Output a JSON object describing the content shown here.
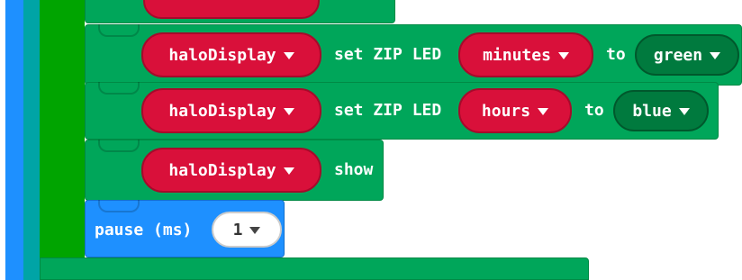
{
  "blocks": {
    "led_minutes": {
      "variable": "haloDisplay",
      "action": "set ZIP LED",
      "led": "minutes",
      "to_label": "to",
      "color": "green"
    },
    "led_hours": {
      "variable": "haloDisplay",
      "action": "set ZIP LED",
      "led": "hours",
      "to_label": "to",
      "color": "blue"
    },
    "show": {
      "variable": "haloDisplay",
      "action": "show"
    },
    "pause": {
      "label": "pause (ms)",
      "value": "1"
    }
  },
  "colors": {
    "green_block": "#00A65A",
    "red_pill": "#D9103A",
    "blue_block": "#1E90FF",
    "teal_edge": "#00A4A6"
  }
}
